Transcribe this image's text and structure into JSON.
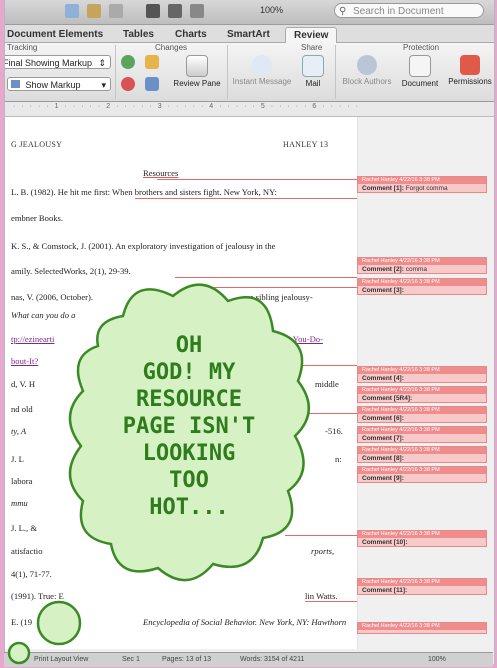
{
  "toolbar": {
    "search_placeholder": "Search in Document",
    "zoom": "100%"
  },
  "tabs": [
    "Document Elements",
    "Tables",
    "Charts",
    "SmartArt",
    "Review"
  ],
  "ribbon": {
    "groups": {
      "tracking": "Tracking",
      "changes": "Changes",
      "share": "Share",
      "protection": "Protection"
    },
    "markup_dropdown": "Final Showing Markup",
    "show_markup": "Show Markup",
    "review_pane": "Review Pane",
    "instant_message": "Instant Message",
    "mail": "Mail",
    "block_authors": "Block Authors",
    "document": "Document",
    "permissions": "Permissions"
  },
  "document": {
    "header_left": "G JEALOUSY",
    "header_right": "HANLEY 13",
    "title": "Resources",
    "lines": [
      "L. B. (1982). He hit me first: When brothers and sisters fight. New York, NY:",
      "embner Books.",
      "K. S., & Comstock, J. (2001). An exploratory investigation of jealousy in the",
      "amily. SelectedWorks, 2(1), 29-39.",
      "nas, V. (2006, October).",
      "What can you do a",
      "tp://ezinearti",
      "bout-It?",
      "d, V. H",
      "nd old",
      "ty, A",
      "J. L",
      "labora",
      "mmu",
      "J. L., &",
      "atisfactio",
      "4(1), 71-77.",
      "(1991). True: E",
      "E. (19",
      "Encyclopedia of Social Behavior. New York, NY: Hawthorn"
    ],
    "right_fragments": [
      "Fein",
      "in Wo",
      "ses sibling jealousy-",
      "at-Can-You-Do-",
      "middle",
      "-516.",
      "n:",
      "rports,",
      "lin Watts."
    ]
  },
  "comments": [
    {
      "author": "Rachel Hanley 4/22/16 3:38 PM",
      "label": "Comment [1]:",
      "text": "Forgot comma"
    },
    {
      "author": "Rachel Hanley 4/22/16 3:38 PM",
      "label": "Comment [2]:",
      "text": "comma"
    },
    {
      "author": "Rachel Hanley 4/22/16 3:38 PM",
      "label": "Comment [3]:",
      "text": ""
    },
    {
      "author": "Rachel Hanley 4/22/16 3:38 PM",
      "label": "Comment [4]:",
      "text": ""
    },
    {
      "author": "Rachel Hanley 4/22/16 3:38 PM",
      "label": "Comment [5R4]:",
      "text": ""
    },
    {
      "author": "Rachel Hanley 4/22/16 3:38 PM",
      "label": "Comment [6]:",
      "text": ""
    },
    {
      "author": "Rachel Hanley 4/22/16 3:38 PM",
      "label": "Comment [7]:",
      "text": ""
    },
    {
      "author": "Rachel Hanley 4/22/16 3:38 PM",
      "label": "Comment [8]:",
      "text": ""
    },
    {
      "author": "Rachel Hanley 4/22/16 3:38 PM",
      "label": "Comment [9]:",
      "text": ""
    },
    {
      "author": "Rachel Hanley 4/22/16 3:38 PM",
      "label": "Comment [10]:",
      "text": ""
    },
    {
      "author": "Rachel Hanley 4/22/16 3:38 PM",
      "label": "Comment [11]:",
      "text": ""
    },
    {
      "author": "Rachel Hanley 4/22/16 3:38 PM",
      "label": "",
      "text": ""
    }
  ],
  "status": {
    "view": "Print Layout View",
    "sec": "Sec 1",
    "pages": "Pages: 13 of 13",
    "words": "Words: 3154 of 4211",
    "zoom": "100%"
  },
  "bubble_text": [
    "OH",
    "GOD! MY",
    "RESOURCE",
    "PAGE ISN'T",
    "LOOKING",
    "TOO",
    "HOT..."
  ],
  "colors": {
    "bubble_fill": "#d6f2c4",
    "bubble_stroke": "#3c8a26",
    "bubble_text": "#2e7d1c",
    "comment_header": "#ef8c8c",
    "frame": "#e6a8cf"
  }
}
